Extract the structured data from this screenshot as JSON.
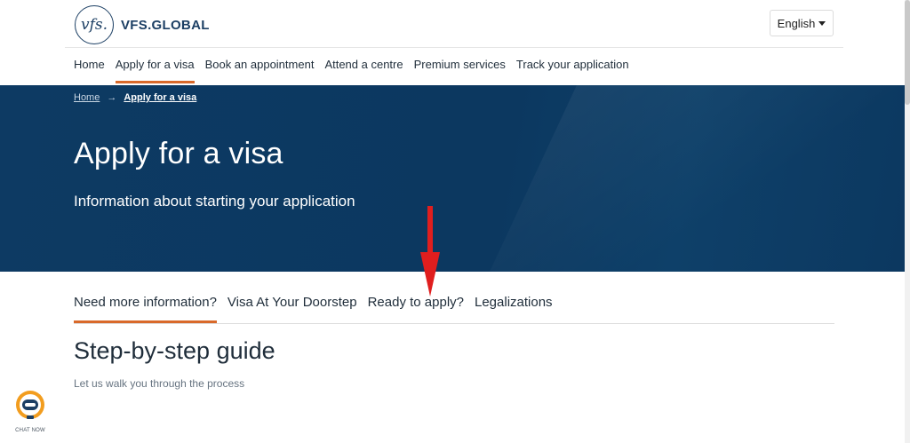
{
  "header": {
    "logo_mark": "vfs.",
    "logo_text": "VFS.GLOBAL",
    "language": "English",
    "nav": [
      {
        "label": "Home",
        "active": false
      },
      {
        "label": "Apply for a visa",
        "active": true
      },
      {
        "label": "Book an appointment",
        "active": false
      },
      {
        "label": "Attend a centre",
        "active": false
      },
      {
        "label": "Premium services",
        "active": false
      },
      {
        "label": "Track your application",
        "active": false
      }
    ]
  },
  "hero": {
    "breadcrumb": [
      {
        "label": "Home"
      },
      {
        "label": "Apply for a visa"
      }
    ],
    "title": "Apply for a visa",
    "subtitle": "Information about starting your application",
    "background": "#0c3860"
  },
  "tabs": [
    {
      "label": "Need more information?",
      "active": true
    },
    {
      "label": "Visa At Your Doorstep",
      "active": false
    },
    {
      "label": "Ready to apply?",
      "active": false
    },
    {
      "label": "Legalizations",
      "active": false
    }
  ],
  "section": {
    "title": "Step-by-step guide",
    "subtitle": "Let us walk you through the process"
  },
  "chat": {
    "label": "CHAT NOW"
  },
  "colors": {
    "accent": "#d9692a",
    "brand": "#1c3f64",
    "annotation": "#e01e1e"
  },
  "icons": {
    "dropdown": "caret-down-icon",
    "breadcrumb_separator": "arrow-right-icon",
    "chat": "chat-bot-icon",
    "annotation": "red-arrow-down-icon"
  }
}
